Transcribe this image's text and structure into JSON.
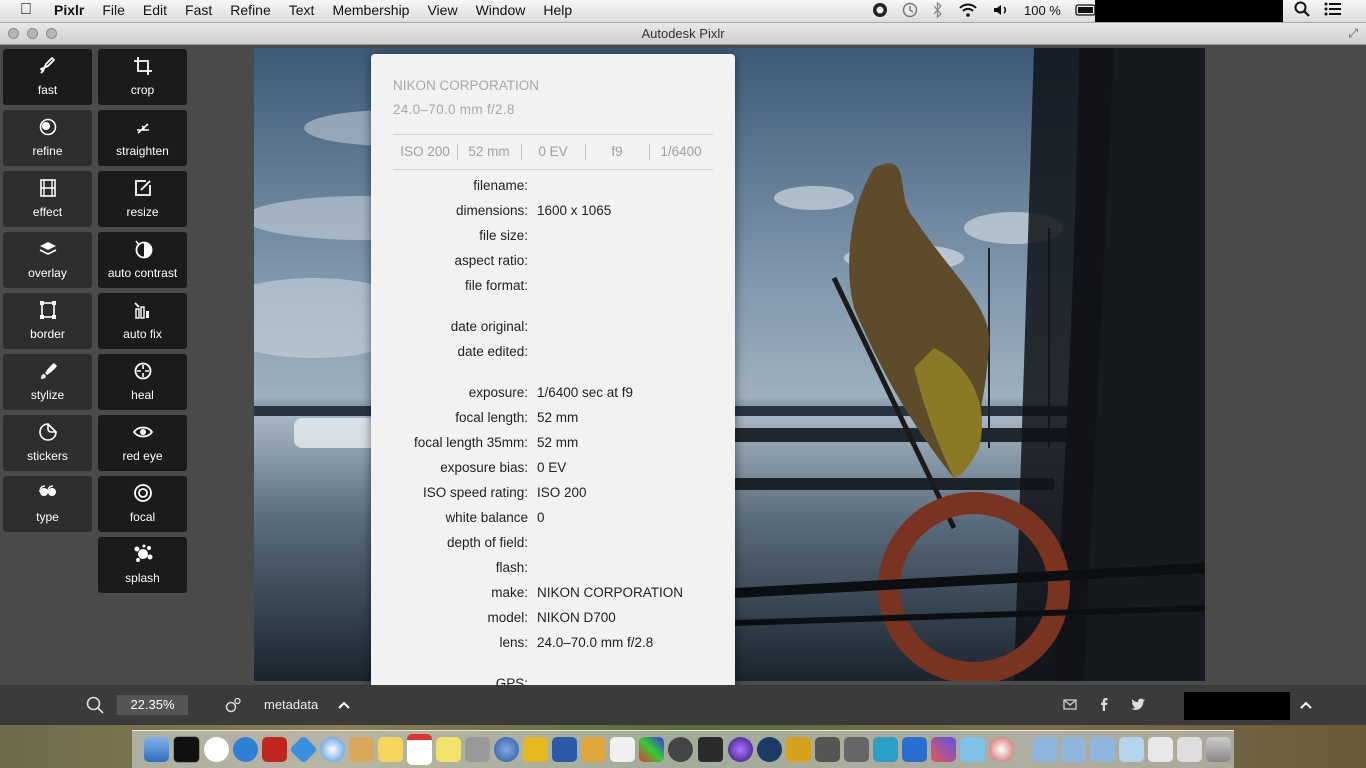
{
  "menubar": {
    "apple_icon": "apple-logo-icon",
    "items": [
      "Pixlr",
      "File",
      "Edit",
      "Fast",
      "Refine",
      "Text",
      "Membership",
      "View",
      "Window",
      "Help"
    ],
    "battery": "100 %"
  },
  "window": {
    "title": "Autodesk Pixlr"
  },
  "tools": {
    "left": [
      {
        "label": "fast",
        "icon": "rocket-icon"
      },
      {
        "label": "refine",
        "icon": "refine-icon"
      },
      {
        "label": "effect",
        "icon": "film-icon"
      },
      {
        "label": "overlay",
        "icon": "layers-icon"
      },
      {
        "label": "border",
        "icon": "border-icon"
      },
      {
        "label": "stylize",
        "icon": "brush-icon"
      },
      {
        "label": "stickers",
        "icon": "sticker-icon"
      },
      {
        "label": "type",
        "icon": "quote-icon"
      }
    ],
    "right": [
      {
        "label": "crop",
        "icon": "crop-icon"
      },
      {
        "label": "straighten",
        "icon": "straighten-icon"
      },
      {
        "label": "resize",
        "icon": "resize-icon"
      },
      {
        "label": "auto contrast",
        "icon": "contrast-icon"
      },
      {
        "label": "auto fix",
        "icon": "auto-fix-icon"
      },
      {
        "label": "heal",
        "icon": "heal-icon"
      },
      {
        "label": "red eye",
        "icon": "eye-icon"
      },
      {
        "label": "focal",
        "icon": "focal-icon"
      },
      {
        "label": "splash",
        "icon": "splash-icon"
      }
    ]
  },
  "metadata_popup": {
    "camera": "NIKON CORPORATION",
    "lens": "24.0–70.0 mm f/2.8",
    "summary": [
      "ISO 200",
      "52 mm",
      "0 EV",
      "f9",
      "1/6400"
    ],
    "rows": [
      {
        "key": "filename:",
        "value": ""
      },
      {
        "key": "dimensions:",
        "value": "1600 x 1065"
      },
      {
        "key": "file size:",
        "value": ""
      },
      {
        "key": "aspect ratio:",
        "value": ""
      },
      {
        "key": "file format:",
        "value": ""
      },
      {
        "key": "date original:",
        "value": ""
      },
      {
        "key": "date edited:",
        "value": ""
      },
      {
        "key": "exposure:",
        "value": "1/6400 sec at f9"
      },
      {
        "key": "focal length:",
        "value": "52 mm"
      },
      {
        "key": "focal length 35mm:",
        "value": "52 mm"
      },
      {
        "key": "exposure bias:",
        "value": "0 EV"
      },
      {
        "key": "ISO speed rating:",
        "value": "ISO 200"
      },
      {
        "key": "white balance",
        "value": "0"
      },
      {
        "key": "depth of field:",
        "value": ""
      },
      {
        "key": "flash:",
        "value": ""
      },
      {
        "key": "make:",
        "value": "NIKON CORPORATION"
      },
      {
        "key": "model:",
        "value": "NIKON D700"
      },
      {
        "key": "lens:",
        "value": "24.0–70.0 mm f/2.8"
      },
      {
        "key": "GPS:",
        "value": ""
      }
    ]
  },
  "bottombar": {
    "zoom": "22.35%",
    "metadata_label": "metadata",
    "share_icons": [
      "mail-icon",
      "facebook-icon",
      "twitter-icon"
    ]
  },
  "dock": {
    "apps": [
      "finder",
      "terminal",
      "app-c",
      "teamviewer",
      "filezilla",
      "dropbox",
      "safari",
      "contacts",
      "notes",
      "calendar",
      "stickies",
      "calculator",
      "itunes",
      "app-pen",
      "word",
      "app-a",
      "preview",
      "app-b",
      "photo-booth",
      "lightroom",
      "app-d",
      "app-e",
      "app-f",
      "app-g",
      "app-h",
      "app-i",
      "app-j",
      "app-k",
      "app-l",
      "app-m",
      "folder-a",
      "folder-b",
      "folder-c",
      "folder-d",
      "folder-e",
      "folder-f",
      "trash"
    ]
  }
}
